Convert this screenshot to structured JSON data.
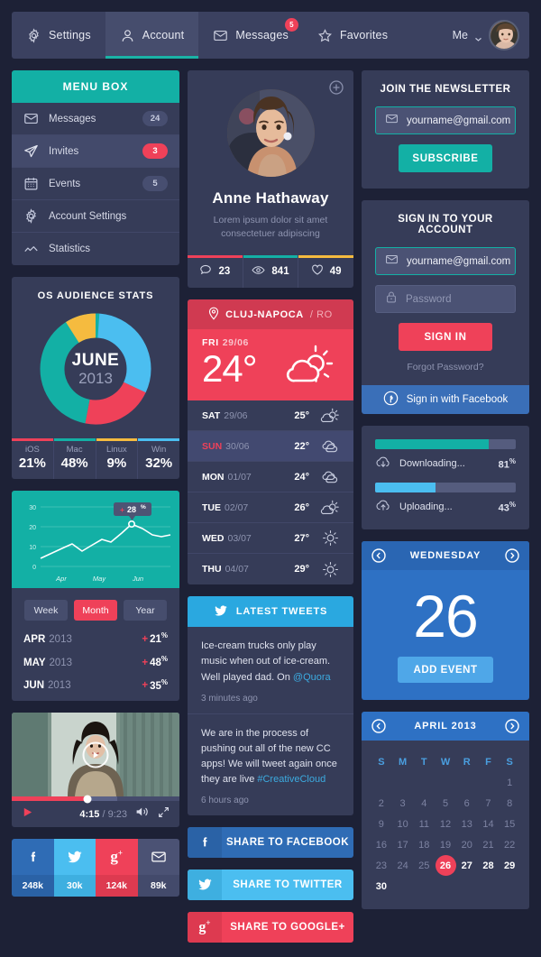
{
  "nav": {
    "items": [
      {
        "label": "Settings",
        "icon": "gear-icon",
        "active": false,
        "badge": null
      },
      {
        "label": "Account",
        "icon": "user-icon",
        "active": true,
        "badge": null
      },
      {
        "label": "Messages",
        "icon": "envelope-icon",
        "active": false,
        "badge": "5"
      },
      {
        "label": "Favorites",
        "icon": "star-icon",
        "active": false,
        "badge": null
      }
    ],
    "me_label": "Me"
  },
  "menu_box": {
    "title": "MENU BOX",
    "items": [
      {
        "label": "Messages",
        "count": "24",
        "icon": "envelope-icon",
        "active": false,
        "red": false
      },
      {
        "label": "Invites",
        "count": "3",
        "icon": "paper-plane-icon",
        "active": true,
        "red": true
      },
      {
        "label": "Events",
        "count": "5",
        "icon": "calendar-icon",
        "active": false,
        "red": false
      },
      {
        "label": "Account Settings",
        "count": "",
        "icon": "gear-icon",
        "active": false,
        "red": false
      },
      {
        "label": "Statistics",
        "count": "",
        "icon": "chart-line-icon",
        "active": false,
        "red": false
      }
    ]
  },
  "os_stats": {
    "title": "OS AUDIENCE STATS",
    "center_month": "JUNE",
    "center_year": "2013"
  },
  "line_chart": {
    "badge": "+ 28",
    "badge_sup": "%",
    "tabs": [
      {
        "label": "Week",
        "active": false
      },
      {
        "label": "Month",
        "active": true
      },
      {
        "label": "Year",
        "active": false
      }
    ],
    "rows": [
      {
        "month": "APR",
        "year": "2013",
        "value": "21",
        "sup": "%"
      },
      {
        "month": "MAY",
        "year": "2013",
        "value": "48",
        "sup": "%"
      },
      {
        "month": "JUN",
        "year": "2013",
        "value": "35",
        "sup": "%"
      }
    ]
  },
  "video": {
    "current_time": "4:15",
    "total_time": "/ 9:23"
  },
  "social_counts": [
    {
      "network": "facebook",
      "icon": "facebook-icon",
      "count": "248k",
      "color": "#2f6cb5",
      "num_color": "#2a62a6"
    },
    {
      "network": "twitter",
      "icon": "twitter-icon",
      "count": "30k",
      "color": "#4bbef0",
      "num_color": "#3eafe0"
    },
    {
      "network": "googleplus",
      "icon": "googleplus-icon",
      "count": "124k",
      "color": "#ef4159",
      "num_color": "#dd3a50"
    },
    {
      "network": "email",
      "icon": "envelope-icon",
      "count": "89k",
      "color": "#4b5274",
      "num_color": "#434a6b"
    }
  ],
  "profile": {
    "name": "Anne Hathaway",
    "subtitle_line1": "Lorem ipsum dolor sit amet",
    "subtitle_line2": "consectetuer adipiscing",
    "stats": [
      {
        "icon": "comment-icon",
        "value": "23",
        "color": "#ef4159"
      },
      {
        "icon": "eye-icon",
        "value": "841",
        "color": "#13b0a5"
      },
      {
        "icon": "heart-icon",
        "value": "49",
        "color": "#f5bb3f"
      }
    ]
  },
  "weather": {
    "city": "CLUJ-NAPOCA",
    "country": "/ RO",
    "today_day": "FRI",
    "today_date": "29/06",
    "today_temp": "24°",
    "today_icon": "sun-cloud-icon",
    "forecast": [
      {
        "day": "SAT",
        "date": "29/06",
        "temp": "25°",
        "icon": "sun-cloud-icon",
        "highlight": false,
        "sunday": false
      },
      {
        "day": "SUN",
        "date": "30/06",
        "temp": "22°",
        "icon": "cloud-icon",
        "highlight": true,
        "sunday": true
      },
      {
        "day": "MON",
        "date": "01/07",
        "temp": "24°",
        "icon": "cloud-icon",
        "highlight": false,
        "sunday": false
      },
      {
        "day": "TUE",
        "date": "02/07",
        "temp": "26°",
        "icon": "sun-cloud-icon",
        "highlight": false,
        "sunday": false
      },
      {
        "day": "WED",
        "date": "03/07",
        "temp": "27°",
        "icon": "sun-icon",
        "highlight": false,
        "sunday": false
      },
      {
        "day": "THU",
        "date": "04/07",
        "temp": "29°",
        "icon": "sun-icon",
        "highlight": false,
        "sunday": false
      }
    ]
  },
  "tweets": {
    "title": "LATEST TWEETS",
    "items": [
      {
        "text": "Ice-cream trucks only play music when out of ice-cream. Well played dad. On ",
        "link": "@Quora",
        "time": "3 minutes ago"
      },
      {
        "text": "We are in the process of pushing out all of the new CC apps! We will tweet again once they are live ",
        "link": "#CreativeCloud",
        "time": "6 hours ago"
      }
    ]
  },
  "share_buttons": [
    {
      "label": "SHARE TO FACEBOOK",
      "icon": "facebook-icon",
      "bg": "#2f6cb5",
      "icon_bg": "#2a62a6"
    },
    {
      "label": "SHARE TO TWITTER",
      "icon": "twitter-icon",
      "bg": "#4bbef0",
      "icon_bg": "#3eafe0"
    },
    {
      "label": "SHARE TO GOOGLE+",
      "icon": "googleplus-icon",
      "bg": "#ef4159",
      "icon_bg": "#dd3a50"
    }
  ],
  "newsletter": {
    "title": "JOIN THE NEWSLETTER",
    "email_value": "yourname@gmail.com",
    "email_placeholder": "yourname@gmail.com",
    "button": "SUBSCRIBE"
  },
  "signin": {
    "title": "SIGN IN TO YOUR ACCOUNT",
    "email_value": "yourname@gmail.com",
    "password_placeholder": "Password",
    "button": "SIGN IN",
    "forgot": "Forgot Password?",
    "facebook": "Sign in with Facebook"
  },
  "progress": [
    {
      "label": "Downloading...",
      "percent": "81",
      "sup": "%",
      "value": 81,
      "color": "#13b0a5",
      "icon": "cloud-download-icon"
    },
    {
      "label": "Uploading...",
      "percent": "43",
      "sup": "%",
      "value": 43,
      "color": "#4bbef0",
      "icon": "cloud-upload-icon"
    }
  ],
  "day_card": {
    "weekday": "WEDNESDAY",
    "day_number": "26",
    "add_event": "ADD EVENT"
  },
  "calendar": {
    "title": "APRIL 2013",
    "dow": [
      "S",
      "M",
      "T",
      "W",
      "R",
      "F",
      "S"
    ],
    "weeks": [
      [
        "",
        "",
        "",
        "",
        "",
        "",
        "1"
      ],
      [
        "2",
        "3",
        "4",
        "5",
        "6",
        "7",
        "8"
      ],
      [
        "9",
        "10",
        "11",
        "12",
        "13",
        "14",
        "15"
      ],
      [
        "16",
        "17",
        "18",
        "19",
        "20",
        "21",
        "22"
      ],
      [
        "23",
        "24",
        "25",
        "26",
        "27",
        "28",
        "29"
      ],
      [
        "30",
        "",
        "",
        "",
        "",
        "",
        ""
      ]
    ],
    "today": "26",
    "bright_days": [
      "27",
      "28",
      "29",
      "30"
    ]
  },
  "colors": {
    "bg": "#1d2136",
    "card": "#363c58",
    "teal": "#13b0a5",
    "red": "#ef4159",
    "blue": "#2e71c4",
    "light_blue": "#4bbef0",
    "yellow": "#f5bb3f"
  },
  "chart_data": [
    {
      "type": "pie",
      "title": "OS AUDIENCE STATS",
      "labels": [
        "iOS",
        "Mac",
        "Linux",
        "Win"
      ],
      "values": [
        21,
        48,
        9,
        32
      ],
      "display_values": [
        "21%",
        "48%",
        "9%",
        "32%"
      ],
      "colors": [
        "#ef4159",
        "#13b0a5",
        "#f5bb3f",
        "#4bbef0"
      ],
      "center_text": "JUNE 2013",
      "legend": "bottom"
    },
    {
      "type": "line",
      "title": "",
      "x": [
        "Apr",
        "May",
        "Jun"
      ],
      "xtick_labels": [
        "Apr",
        "May",
        "Jun"
      ],
      "ytick_labels": [
        "0",
        "10",
        "20",
        "30"
      ],
      "ylim": [
        0,
        33
      ],
      "grid": true,
      "annotation": "+ 28%",
      "series": [
        {
          "name": "growth",
          "values": [
            4,
            8,
            11,
            13,
            9,
            12,
            15,
            14,
            18,
            23,
            20,
            16,
            14,
            15
          ]
        }
      ],
      "table": {
        "rows": [
          {
            "label": "APR 2013",
            "value": "+ 21%"
          },
          {
            "label": "MAY 2013",
            "value": "+ 48%"
          },
          {
            "label": "JUN 2013",
            "value": "+ 35%"
          }
        ]
      }
    }
  ]
}
